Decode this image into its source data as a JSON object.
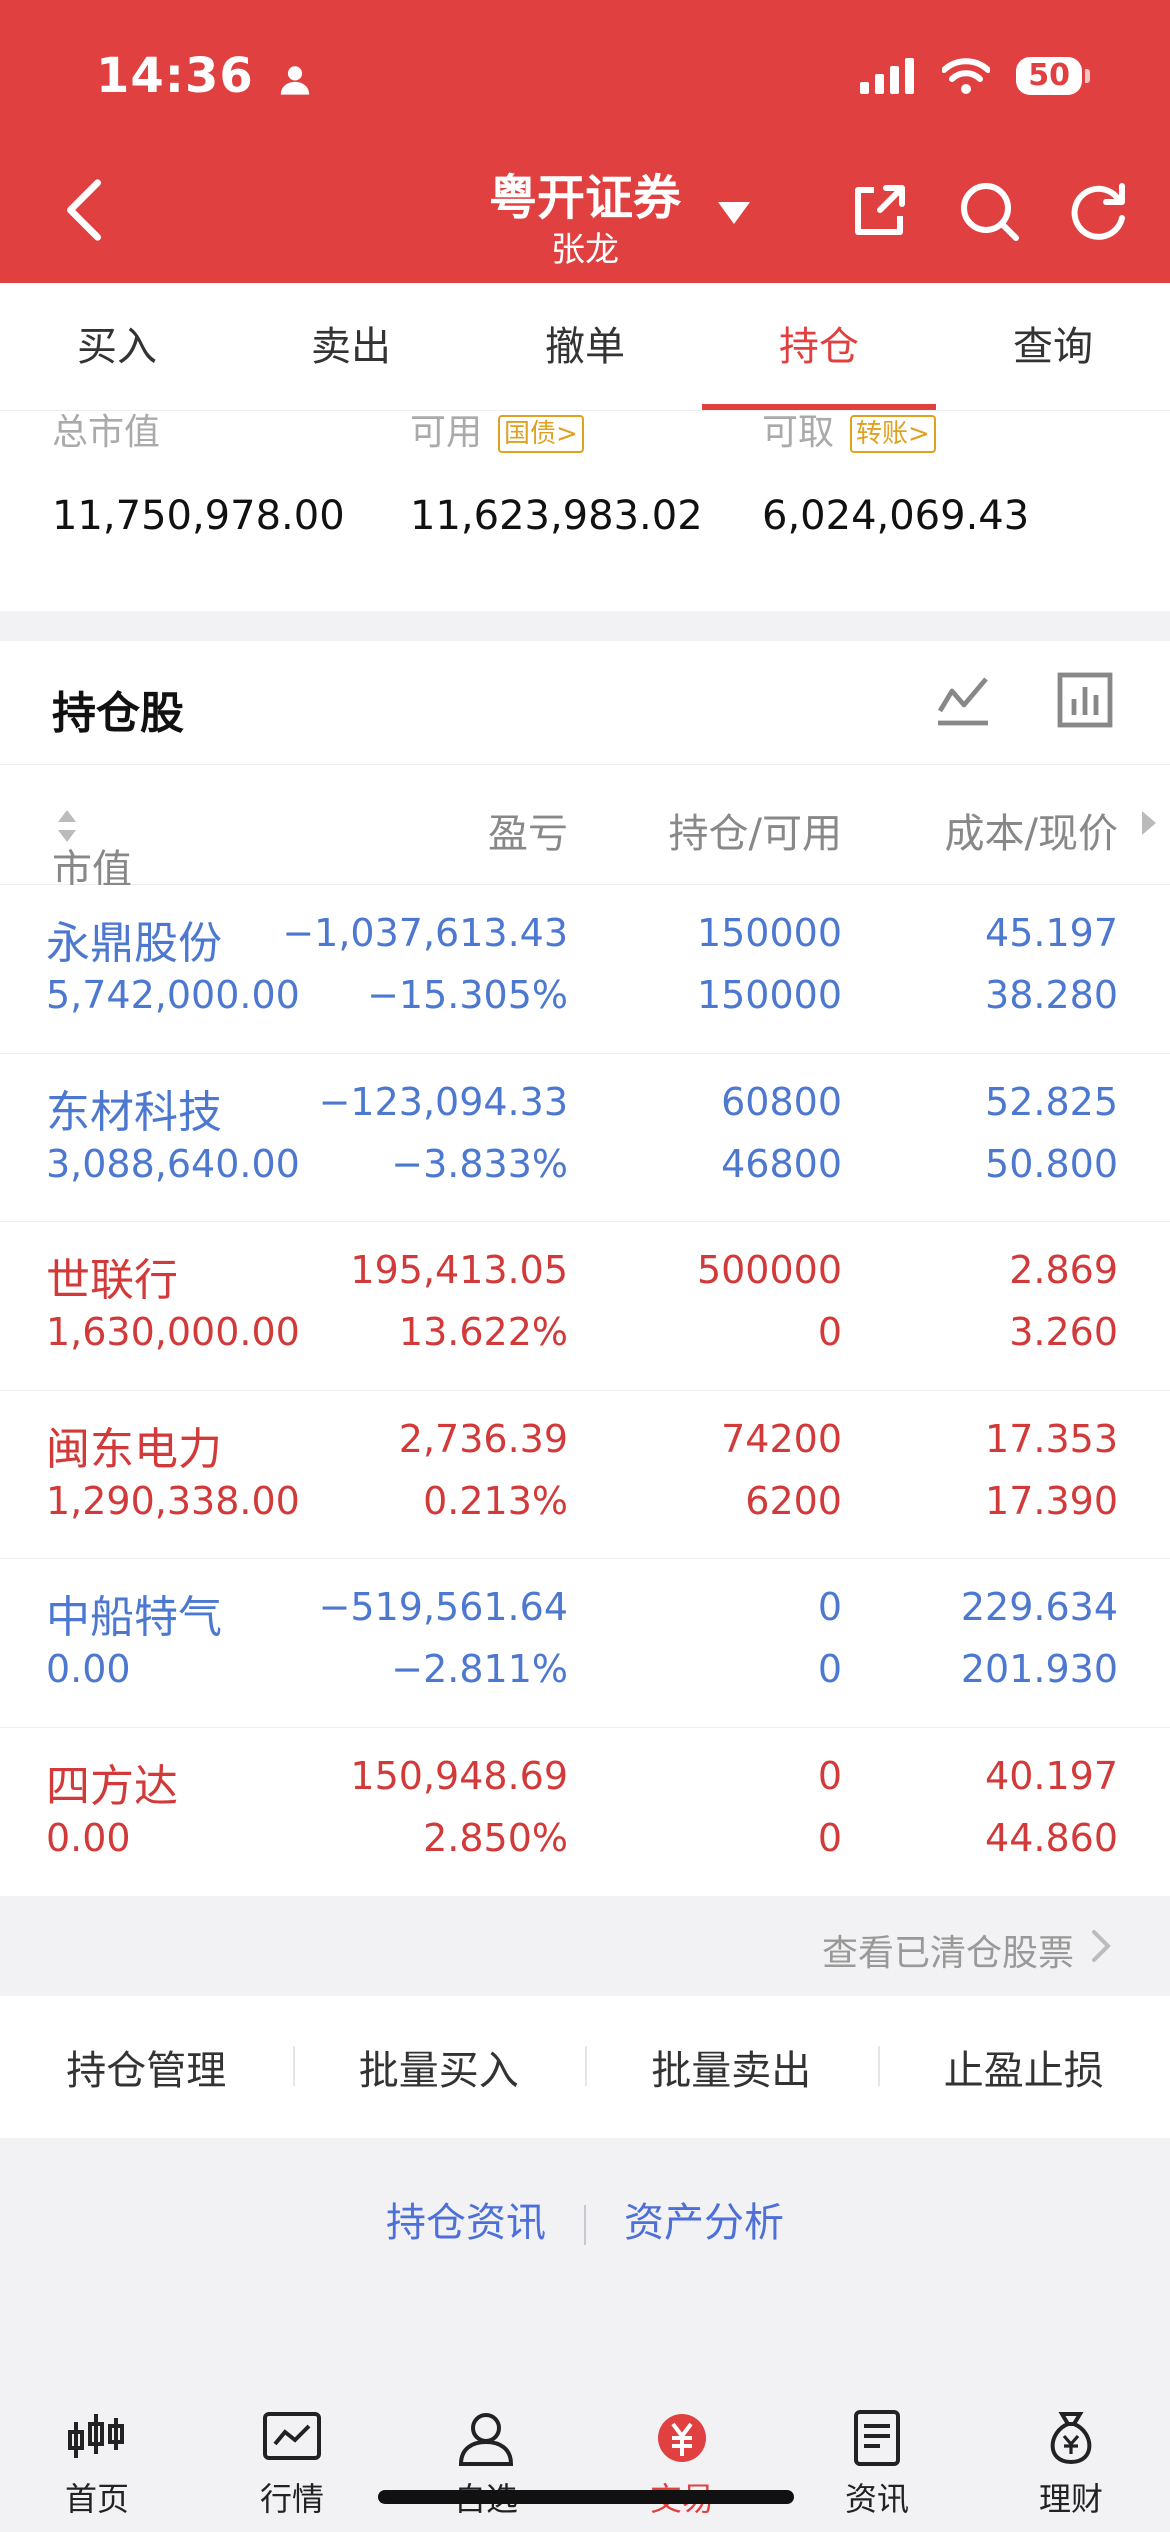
{
  "status_bar": {
    "time": "14:36",
    "battery": "50"
  },
  "nav": {
    "title": "粤开证券",
    "subtitle": "张龙"
  },
  "tabs": [
    {
      "label": "买入",
      "active": false
    },
    {
      "label": "卖出",
      "active": false
    },
    {
      "label": "撤单",
      "active": false
    },
    {
      "label": "持仓",
      "active": true
    },
    {
      "label": "查询",
      "active": false
    }
  ],
  "assets": {
    "total_market_value": {
      "label": "总市值",
      "value": "11,750,978.00"
    },
    "available": {
      "label": "可用",
      "tag": "国债>",
      "value": "11,623,983.02"
    },
    "withdrawable": {
      "label": "可取",
      "tag": "转账>",
      "value": "6,024,069.43"
    }
  },
  "holdings": {
    "title": "持仓股",
    "columns": {
      "market_value": "市值",
      "profit": "盈亏",
      "position": "持仓/可用",
      "cost_price": "成本/现价"
    },
    "rows": [
      {
        "name": "永鼎股份",
        "market_value": "5,742,000.00",
        "profit": "−1,037,613.43",
        "profit_pct": "−15.305%",
        "position": "150000",
        "available": "150000",
        "cost": "45.197",
        "price": "38.280",
        "trend": "down"
      },
      {
        "name": "东材科技",
        "market_value": "3,088,640.00",
        "profit": "−123,094.33",
        "profit_pct": "−3.833%",
        "position": "60800",
        "available": "46800",
        "cost": "52.825",
        "price": "50.800",
        "trend": "down"
      },
      {
        "name": "世联行",
        "market_value": "1,630,000.00",
        "profit": "195,413.05",
        "profit_pct": "13.622%",
        "position": "500000",
        "available": "0",
        "cost": "2.869",
        "price": "3.260",
        "trend": "up"
      },
      {
        "name": "闽东电力",
        "market_value": "1,290,338.00",
        "profit": "2,736.39",
        "profit_pct": "0.213%",
        "position": "74200",
        "available": "6200",
        "cost": "17.353",
        "price": "17.390",
        "trend": "up"
      },
      {
        "name": "中船特气",
        "market_value": "0.00",
        "profit": "−519,561.64",
        "profit_pct": "−2.811%",
        "position": "0",
        "available": "0",
        "cost": "229.634",
        "price": "201.930",
        "trend": "down"
      },
      {
        "name": "四方达",
        "market_value": "0.00",
        "profit": "150,948.69",
        "profit_pct": "2.850%",
        "position": "0",
        "available": "0",
        "cost": "40.197",
        "price": "44.860",
        "trend": "up"
      }
    ]
  },
  "cleared_link": "查看已清仓股票",
  "actions": [
    "持仓管理",
    "批量买入",
    "批量卖出",
    "止盈止损"
  ],
  "links": [
    "持仓资讯",
    "资产分析"
  ],
  "bottom_nav": [
    {
      "label": "首页",
      "icon": "candlestick-icon"
    },
    {
      "label": "行情",
      "icon": "chart-icon"
    },
    {
      "label": "自选",
      "icon": "user-icon"
    },
    {
      "label": "交易",
      "icon": "yuan-icon",
      "active": true
    },
    {
      "label": "资讯",
      "icon": "news-icon"
    },
    {
      "label": "理财",
      "icon": "moneybag-icon"
    }
  ],
  "colors": {
    "brand": "#e04040",
    "up": "#d23a3a",
    "down": "#4d78d0",
    "tag": "#e0a020",
    "link": "#4d6fd8"
  }
}
